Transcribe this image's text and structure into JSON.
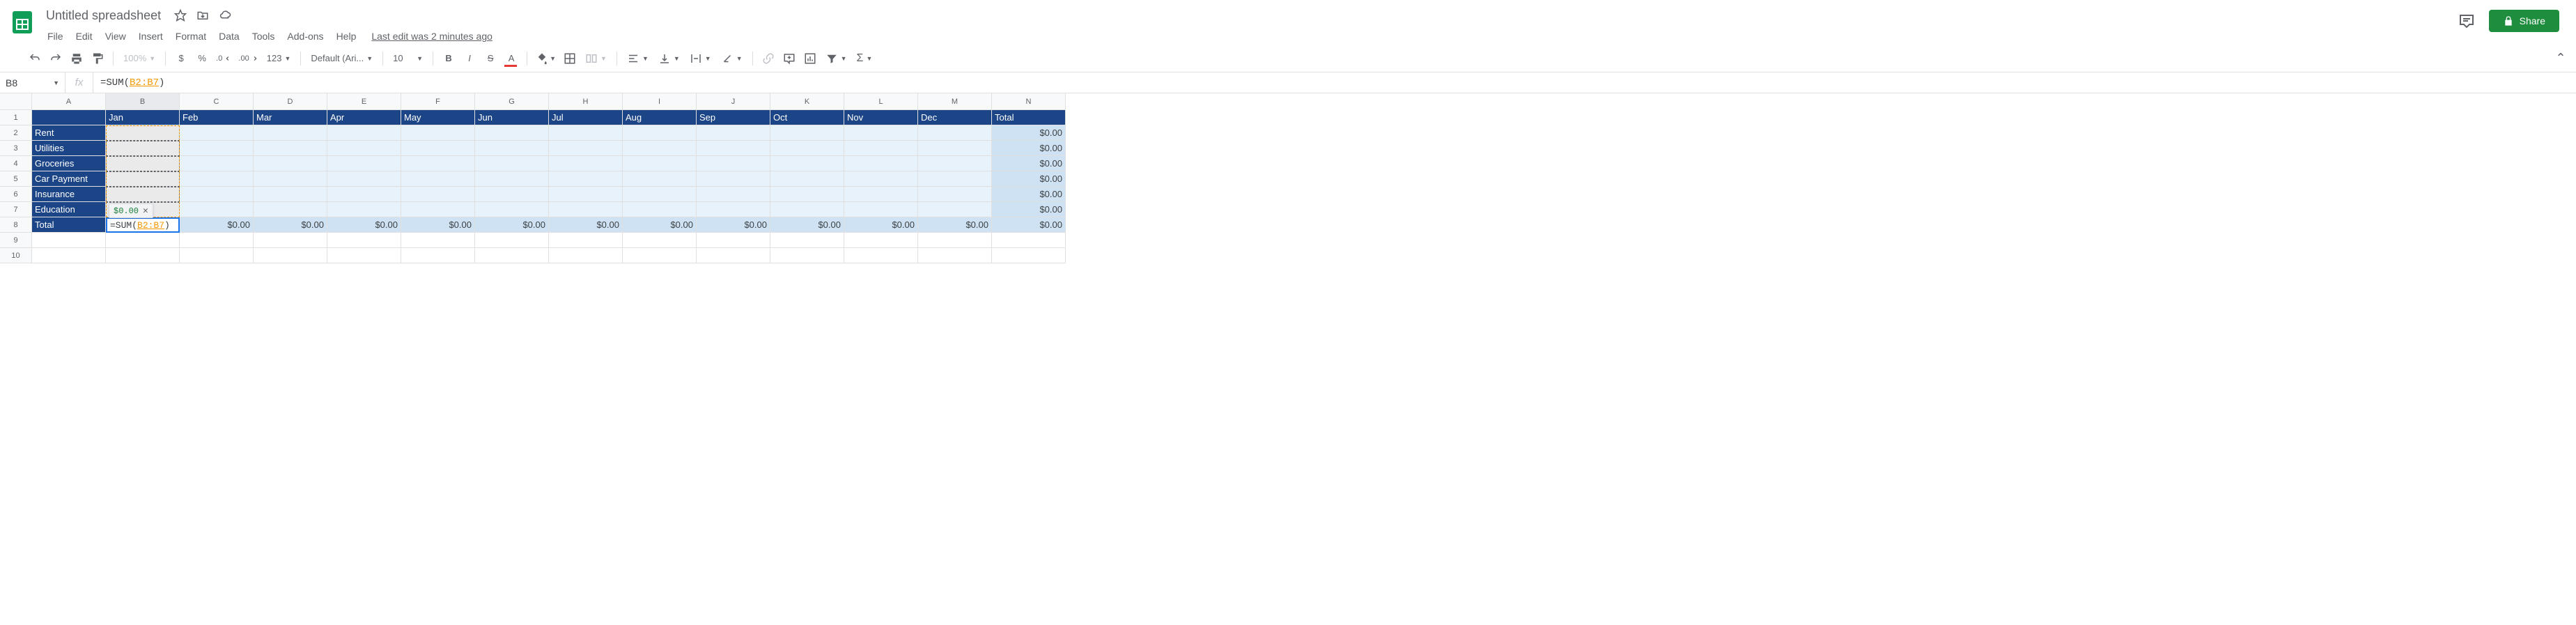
{
  "header": {
    "doc_title": "Untitled spreadsheet",
    "last_edit": "Last edit was 2 minutes ago",
    "share_label": "Share"
  },
  "menubar": [
    "File",
    "Edit",
    "View",
    "Insert",
    "Format",
    "Data",
    "Tools",
    "Add-ons",
    "Help"
  ],
  "toolbar": {
    "zoom": "100%",
    "currency": "$",
    "percent": "%",
    "dec_dec": ".0",
    "dec_inc": ".00",
    "more_fmt": "123",
    "font": "Default (Ari...",
    "size": "10",
    "bold": "B",
    "italic": "I",
    "strike": "S",
    "text_color": "A",
    "functions": "Σ"
  },
  "formula_bar": {
    "name_box": "B8",
    "fx": "fx",
    "prefix": "=SUM(",
    "range": "B2:B7",
    "suffix": ")"
  },
  "columns": [
    "A",
    "B",
    "C",
    "D",
    "E",
    "F",
    "G",
    "H",
    "I",
    "J",
    "K",
    "L",
    "M",
    "N"
  ],
  "row_numbers": [
    "1",
    "2",
    "3",
    "4",
    "5",
    "6",
    "7",
    "8",
    "9",
    "10"
  ],
  "months": [
    "Jan",
    "Feb",
    "Mar",
    "Apr",
    "May",
    "Jun",
    "Jul",
    "Aug",
    "Sep",
    "Oct",
    "Nov",
    "Dec",
    "Total"
  ],
  "categories": [
    "Rent",
    "Utilities",
    "Groceries",
    "Car Payment",
    "Insurance",
    "Education",
    "Total"
  ],
  "zero": "$0.00",
  "active_cell": {
    "prefix": "=SUM(",
    "range": "B2:B7",
    "suffix": ")",
    "tooltip": "$0.00"
  },
  "chart_data": {
    "type": "table",
    "title": "Monthly budget",
    "columns": [
      "Jan",
      "Feb",
      "Mar",
      "Apr",
      "May",
      "Jun",
      "Jul",
      "Aug",
      "Sep",
      "Oct",
      "Nov",
      "Dec",
      "Total"
    ],
    "rows": [
      {
        "label": "Rent",
        "values": [
          null,
          null,
          null,
          null,
          null,
          null,
          null,
          null,
          null,
          null,
          null,
          null,
          0.0
        ]
      },
      {
        "label": "Utilities",
        "values": [
          null,
          null,
          null,
          null,
          null,
          null,
          null,
          null,
          null,
          null,
          null,
          null,
          0.0
        ]
      },
      {
        "label": "Groceries",
        "values": [
          null,
          null,
          null,
          null,
          null,
          null,
          null,
          null,
          null,
          null,
          null,
          null,
          0.0
        ]
      },
      {
        "label": "Car Payment",
        "values": [
          null,
          null,
          null,
          null,
          null,
          null,
          null,
          null,
          null,
          null,
          null,
          null,
          0.0
        ]
      },
      {
        "label": "Insurance",
        "values": [
          null,
          null,
          null,
          null,
          null,
          null,
          null,
          null,
          null,
          null,
          null,
          null,
          0.0
        ]
      },
      {
        "label": "Education",
        "values": [
          null,
          null,
          null,
          null,
          null,
          null,
          null,
          null,
          null,
          null,
          null,
          null,
          0.0
        ]
      },
      {
        "label": "Total",
        "values": [
          null,
          0.0,
          0.0,
          0.0,
          0.0,
          0.0,
          0.0,
          0.0,
          0.0,
          0.0,
          0.0,
          0.0,
          0.0
        ]
      }
    ]
  }
}
